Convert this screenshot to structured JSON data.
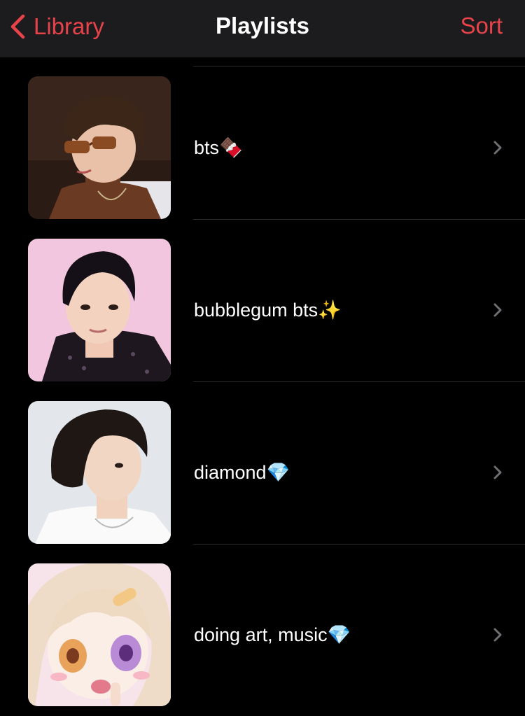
{
  "nav": {
    "back_label": "Library",
    "title": "Playlists",
    "sort_label": "Sort"
  },
  "colors": {
    "accent": "#e8434a",
    "background": "#000000",
    "navbar": "#1c1c1e",
    "separator": "#2c2c2e"
  },
  "playlists": [
    {
      "name": "bts🍫",
      "artwork": "photo-man-sunglasses"
    },
    {
      "name": "bubblegum bts✨",
      "artwork": "photo-man-pink-background"
    },
    {
      "name": "diamond💎",
      "artwork": "photo-man-white-shirt"
    },
    {
      "name": "doing art, music💎",
      "artwork": "anime-girl-illustration"
    }
  ]
}
